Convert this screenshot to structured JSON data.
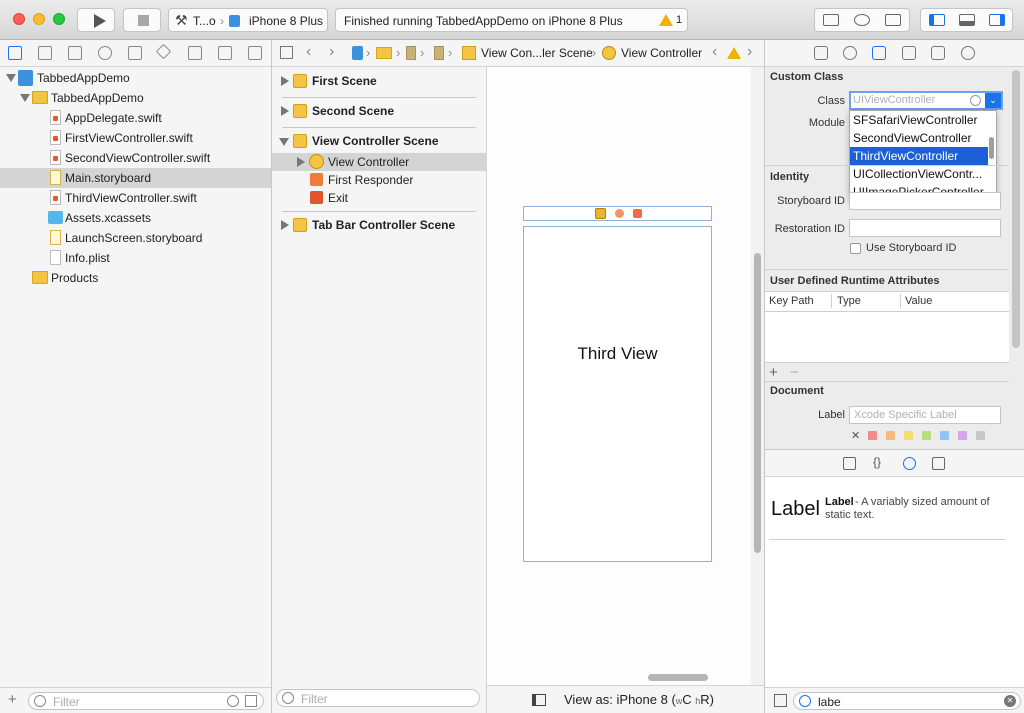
{
  "toolbar": {
    "scheme_target": "T...o",
    "device": "iPhone 8 Plus",
    "status_text": "Finished running TabbedAppDemo on iPhone 8 Plus",
    "warning_count": "1"
  },
  "navigator": {
    "items": [
      {
        "label": "TabbedAppDemo"
      },
      {
        "label": "TabbedAppDemo"
      },
      {
        "label": "AppDelegate.swift"
      },
      {
        "label": "FirstViewController.swift"
      },
      {
        "label": "SecondViewController.swift"
      },
      {
        "label": "Main.storyboard"
      },
      {
        "label": "ThirdViewController.swift"
      },
      {
        "label": "Assets.xcassets"
      },
      {
        "label": "LaunchScreen.storyboard"
      },
      {
        "label": "Info.plist"
      },
      {
        "label": "Products"
      }
    ],
    "filter_placeholder": "Filter"
  },
  "jumpbar": {
    "scene": "View Con...ler Scene",
    "controller": "View Controller"
  },
  "outline": {
    "first_scene": "First Scene",
    "second_scene": "Second Scene",
    "vc_scene": "View Controller Scene",
    "view_controller": "View Controller",
    "first_responder": "First Responder",
    "exit": "Exit",
    "tab_bar_scene": "Tab Bar Controller Scene",
    "filter_placeholder": "Filter"
  },
  "canvas": {
    "view_label": "Third View",
    "view_as": "View as: iPhone 8 (",
    "wc": "w",
    "c": "C ",
    "hr": "h",
    "r": "R)"
  },
  "inspector": {
    "custom_class_title": "Custom Class",
    "class_label": "Class",
    "class_placeholder": "UIViewController",
    "module_label": "Module",
    "dropdown": [
      {
        "label": "SFSafariViewController"
      },
      {
        "label": "SecondViewController"
      },
      {
        "label": "ThirdViewController"
      },
      {
        "label": "UICollectionViewContr..."
      },
      {
        "label": "UIImagePickerController"
      }
    ],
    "identity_title": "Identity",
    "storyboard_id_label": "Storyboard ID",
    "restoration_id_label": "Restoration ID",
    "use_storyboard_id": "Use Storyboard ID",
    "udra_title": "User Defined Runtime Attributes",
    "col_key": "Key Path",
    "col_type": "Type",
    "col_value": "Value",
    "document_title": "Document",
    "doc_label": "Label",
    "doc_label_placeholder": "Xcode Specific Label",
    "swatch_colors": [
      "#f28c8c",
      "#f5b97a",
      "#f3df6e",
      "#b6e07a",
      "#8fc4f2",
      "#d6a6ec",
      "#c8c8c8"
    ]
  },
  "library": {
    "big": "Label",
    "name": "Label",
    "desc": "- A variably sized amount of static text.",
    "search_value": "labe"
  }
}
